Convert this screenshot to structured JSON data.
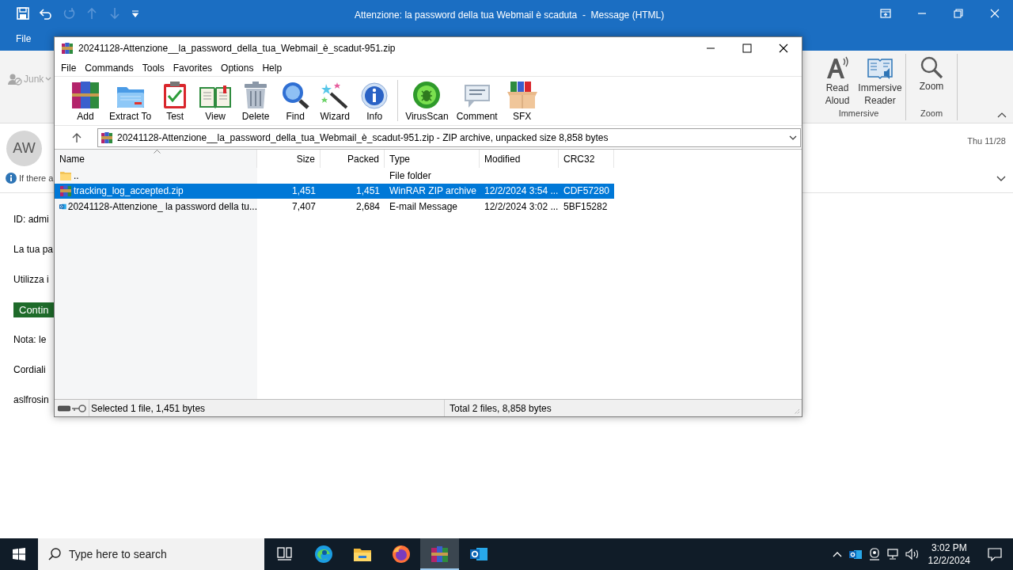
{
  "outlook": {
    "title": "Attenzione: la password della tua Webmail è scaduta  -  Message (HTML)",
    "ribbon_tabs": [
      {
        "label": "File"
      }
    ],
    "junk": "Junk",
    "ribbon_groups": [
      {
        "label": "Immersive",
        "buttons": [
          {
            "kind": "read",
            "label": "Read Aloud"
          },
          {
            "kind": "reader",
            "label": "Immersive Reader"
          }
        ]
      },
      {
        "label": "Zoom",
        "buttons": [
          {
            "kind": "zoom",
            "label": "Zoom"
          }
        ]
      }
    ],
    "message": {
      "avatar": "AW",
      "info": "If there a",
      "date": "Thu 11/28",
      "body": [
        {
          "kind": "text",
          "text": "ID: admi"
        },
        {
          "kind": "text",
          "text": "La tua pa"
        },
        {
          "kind": "text",
          "text": "Utilizza i"
        },
        {
          "kind": "button",
          "text": "Contin"
        },
        {
          "kind": "text",
          "text": "Nota: le"
        },
        {
          "kind": "text",
          "text": "Cordiali"
        },
        {
          "kind": "text",
          "text": "aslfrosin"
        }
      ]
    }
  },
  "winrar": {
    "title": "20241128-Attenzione__la_password_della_tua_Webmail_è_scadut-951.zip",
    "menu": [
      "File",
      "Commands",
      "Tools",
      "Favorites",
      "Options",
      "Help"
    ],
    "toolbar": [
      {
        "kind": "add",
        "label": "Add"
      },
      {
        "kind": "extract",
        "label": "Extract To"
      },
      {
        "kind": "test",
        "label": "Test"
      },
      {
        "kind": "view",
        "label": "View"
      },
      {
        "kind": "delete",
        "label": "Delete"
      },
      {
        "kind": "find",
        "label": "Find"
      },
      {
        "kind": "wizard",
        "label": "Wizard"
      },
      {
        "kind": "info",
        "label": "Info"
      },
      {
        "kind": "virusscan",
        "label": "VirusScan"
      },
      {
        "kind": "comment",
        "label": "Comment"
      },
      {
        "kind": "sfx",
        "label": "SFX"
      }
    ],
    "path": "20241128-Attenzione__la_password_della_tua_Webmail_è_scadut-951.zip - ZIP archive, unpacked size 8,858 bytes",
    "columns": [
      "Name",
      "Size",
      "Packed",
      "Type",
      "Modified",
      "CRC32"
    ],
    "rows": [
      {
        "kind": "folder",
        "name": "..",
        "type": "File folder",
        "selected": false
      },
      {
        "kind": "zip",
        "name": "tracking_log_accepted.zip",
        "size": "1,451",
        "packed": "1,451",
        "type": "WinRAR ZIP archive",
        "modified": "12/2/2024 3:54 ...",
        "crc": "CDF57280",
        "selected": true
      },
      {
        "kind": "email",
        "name": "20241128-Attenzione_ la password della tu...",
        "size": "7,407",
        "packed": "2,684",
        "type": "E-mail Message",
        "modified": "12/2/2024 3:02 ...",
        "crc": "5BF15282",
        "selected": false
      }
    ],
    "status_left": "Selected 1 file, 1,451 bytes",
    "status_right": "Total 2 files, 8,858 bytes"
  },
  "taskbar": {
    "search_placeholder": "Type here to search",
    "apps": [
      {
        "kind": "taskview",
        "selected": false
      },
      {
        "kind": "edge",
        "selected": false
      },
      {
        "kind": "explorer",
        "selected": false
      },
      {
        "kind": "firefox",
        "selected": false
      },
      {
        "kind": "winrar",
        "selected": true
      },
      {
        "kind": "outlook",
        "selected": false
      }
    ],
    "time": "3:02 PM",
    "date": "12/2/2024"
  }
}
